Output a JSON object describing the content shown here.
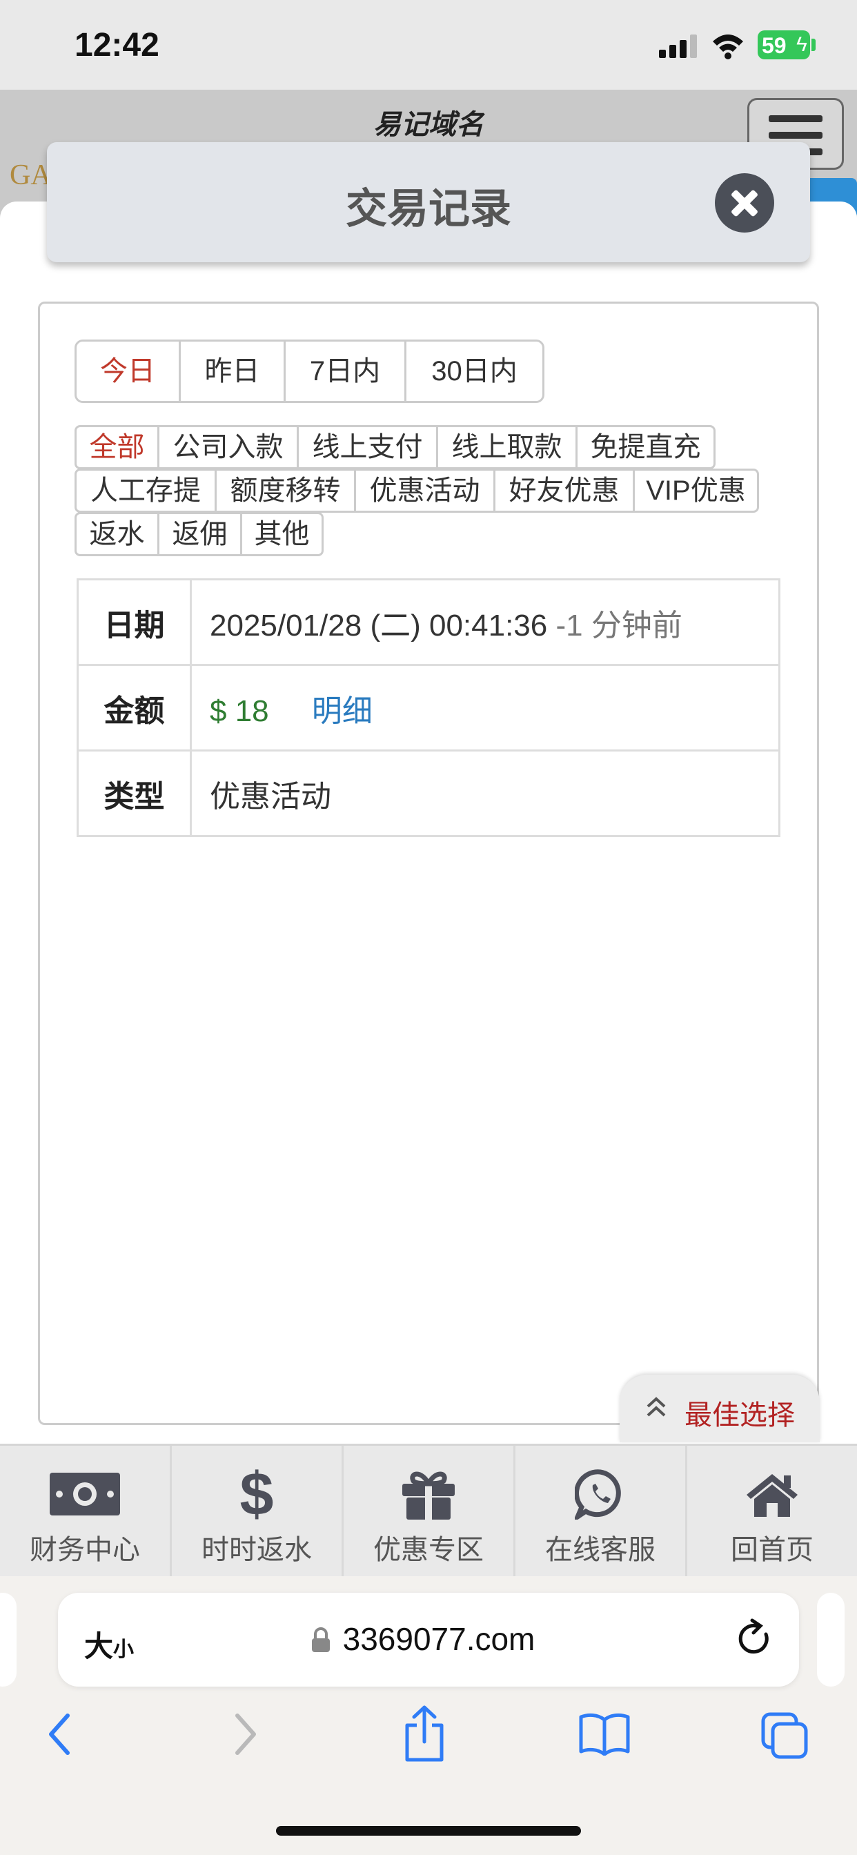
{
  "status_bar": {
    "time": "12:42",
    "battery": "59"
  },
  "site": {
    "name": "易记域名",
    "logo_text": "GA"
  },
  "modal": {
    "title": "交易记录"
  },
  "date_tabs": [
    {
      "label": "今日",
      "active": true
    },
    {
      "label": "昨日",
      "active": false
    },
    {
      "label": "7日内",
      "active": false
    },
    {
      "label": "30日内",
      "active": false
    }
  ],
  "filters": {
    "row1": [
      "全部",
      "公司入款",
      "线上支付",
      "线上取款",
      "免提直充"
    ],
    "row2": [
      "人工存提",
      "额度移转",
      "优惠活动",
      "好友优惠",
      "VIP优惠"
    ],
    "row3": [
      "返水",
      "返佣",
      "其他"
    ],
    "active": "全部"
  },
  "record": {
    "date_key": "日期",
    "date_value": "2025/01/28 (二) 00:41:36",
    "date_relative": "-1 分钟前",
    "amount_key": "金额",
    "amount_value": "$ 18",
    "detail_link": "明细",
    "type_key": "类型",
    "type_value": "优惠活动"
  },
  "best_choice": {
    "label": "最佳选择"
  },
  "bottom_nav": [
    {
      "label": "财务中心",
      "icon": "money-bill-icon"
    },
    {
      "label": "时时返水",
      "icon": "dollar-icon"
    },
    {
      "label": "优惠专区",
      "icon": "gift-icon"
    },
    {
      "label": "在线客服",
      "icon": "whatsapp-icon"
    },
    {
      "label": "回首页",
      "icon": "home-icon"
    }
  ],
  "browser": {
    "text_size_big": "大",
    "text_size_small": "小",
    "url": "3369077.com"
  },
  "colors": {
    "active": "#c0392b",
    "amount": "#2f7d32",
    "link": "#2a7bbf",
    "battery": "#34c759"
  }
}
